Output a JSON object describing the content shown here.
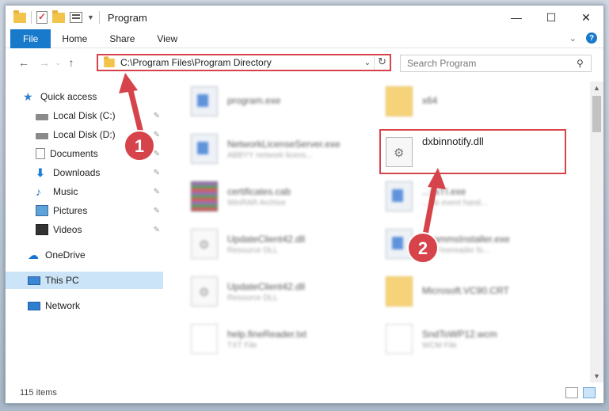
{
  "window": {
    "title": "Program"
  },
  "ribbon": {
    "tabs": [
      "File",
      "Home",
      "Share",
      "View"
    ]
  },
  "nav": {
    "address": "C:\\Program Files\\Program Directory",
    "search_placeholder": "Search Program"
  },
  "sidebar": {
    "quick_access": "Quick access",
    "items": [
      {
        "label": "Local Disk (C:)",
        "icon": "disk-icon",
        "pinned": true
      },
      {
        "label": "Local Disk (D:)",
        "icon": "disk-icon",
        "pinned": true
      },
      {
        "label": "Documents",
        "icon": "documents-icon",
        "pinned": true
      },
      {
        "label": "Downloads",
        "icon": "downloads-icon",
        "pinned": true
      },
      {
        "label": "Music",
        "icon": "music-icon",
        "pinned": true
      },
      {
        "label": "Pictures",
        "icon": "pictures-icon",
        "pinned": true
      },
      {
        "label": "Videos",
        "icon": "videos-icon",
        "pinned": true
      }
    ],
    "onedrive": "OneDrive",
    "this_pc": "This PC",
    "network": "Network"
  },
  "files": [
    {
      "name": "program.exe",
      "desc": "",
      "icon": "exe"
    },
    {
      "name": "x64",
      "desc": "",
      "icon": "folder"
    },
    {
      "name": "NetworkLicenseServer.exe",
      "desc": "ABBYY network licens...",
      "icon": "exe"
    },
    {
      "name": "dxbinnotify.dll",
      "desc": "",
      "icon": "dll"
    },
    {
      "name": "certificates.cab",
      "desc": "WinRAR Archive",
      "icon": "cab"
    },
    {
      "name": "...ysTI.exe",
      "desc": "... ds event hand...",
      "icon": "exe"
    },
    {
      "name": "UpdateClient42.dll",
      "desc": "Resource DLL",
      "icon": "dll"
    },
    {
      "name": "...rammsInstaller.exe",
      "desc": "...Y Finereader fo...",
      "icon": "exe"
    },
    {
      "name": "UpdateClient42.dll",
      "desc": "Resource DLL",
      "icon": "dll"
    },
    {
      "name": "Microsoft.VC90.CRT",
      "desc": "",
      "icon": "folder"
    },
    {
      "name": "help.fineReader.txt",
      "desc": "TXT File",
      "icon": "txt"
    },
    {
      "name": "SndToWP12.wcm",
      "desc": "WCM File",
      "icon": "txt"
    }
  ],
  "status": {
    "count": "115 items"
  },
  "annotations": {
    "step1": "1",
    "step2": "2",
    "color": "#d6434a"
  }
}
